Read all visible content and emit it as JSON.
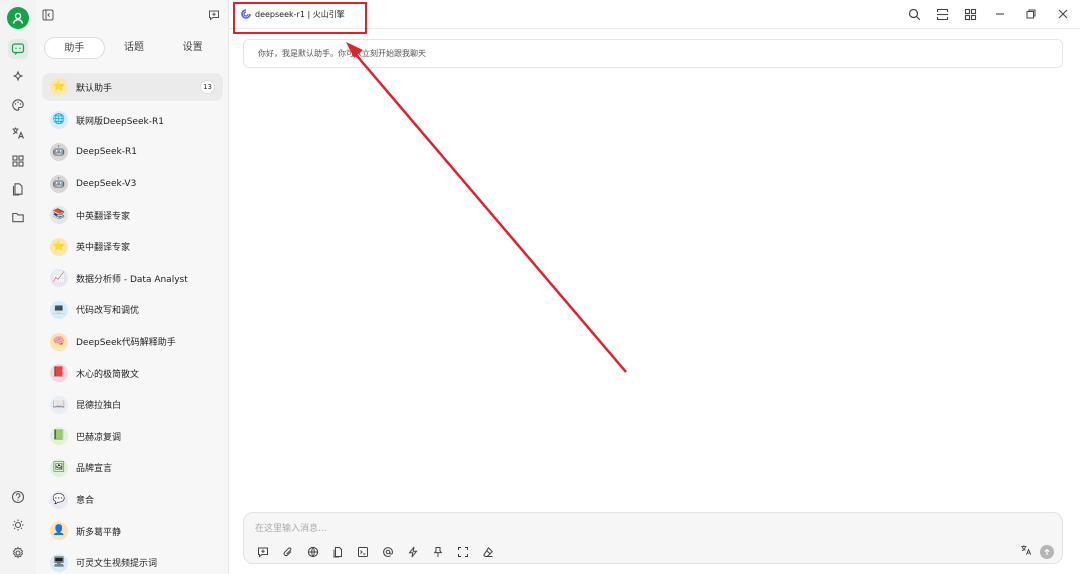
{
  "top_bar": {
    "model_label": "deepseek-r1 | 火山引擎"
  },
  "sidebar": {
    "tabs": [
      {
        "label": "助手",
        "active": true
      },
      {
        "label": "话题",
        "active": false
      },
      {
        "label": "设置",
        "active": false
      }
    ],
    "assistants": [
      {
        "name": "默认助手",
        "emoji": "⭐",
        "bg": "#fde7a6",
        "count": "13",
        "active": true
      },
      {
        "name": "联网版DeepSeek-R1",
        "emoji": "🌐",
        "bg": "#dbeafe"
      },
      {
        "name": "DeepSeek-R1",
        "emoji": "🤖",
        "bg": "#d7d7d7"
      },
      {
        "name": "DeepSeek-V3",
        "emoji": "🤖",
        "bg": "#d7d7d7"
      },
      {
        "name": "中英翻译专家",
        "emoji": "📚",
        "bg": "#e5e5e5"
      },
      {
        "name": "英中翻译专家",
        "emoji": "⭐",
        "bg": "#fde7a6"
      },
      {
        "name": "数据分析师 - Data Analyst",
        "emoji": "📈",
        "bg": "#e6e7f3"
      },
      {
        "name": "代码改写和调优",
        "emoji": "💻",
        "bg": "#d6ecfa"
      },
      {
        "name": "DeepSeek代码解释助手",
        "emoji": "🧠",
        "bg": "#fde3b0"
      },
      {
        "name": "木心的极简散文",
        "emoji": "📕",
        "bg": "#f8d4dc"
      },
      {
        "name": "昆德拉独白",
        "emoji": "📖",
        "bg": "#e8eef6"
      },
      {
        "name": "巴赫凉复调",
        "emoji": "📗",
        "bg": "#dff3d6"
      },
      {
        "name": "品牌宣言",
        "emoji": "🖼",
        "bg": "#dff3d6"
      },
      {
        "name": "意合",
        "emoji": "💬",
        "bg": "#ece8f3"
      },
      {
        "name": "斯多葛平静",
        "emoji": "👤",
        "bg": "#fde3b0"
      },
      {
        "name": "可灵文生视频提示词",
        "emoji": "🖥",
        "bg": "#d6ecfa"
      }
    ]
  },
  "chat": {
    "welcome_message": "你好，我是默认助手。你可以立刻开始跟我聊天",
    "input_placeholder": "在这里输入消息..."
  },
  "colors": {
    "accent_green": "#15a34a",
    "annotation_red": "#e0202a"
  }
}
